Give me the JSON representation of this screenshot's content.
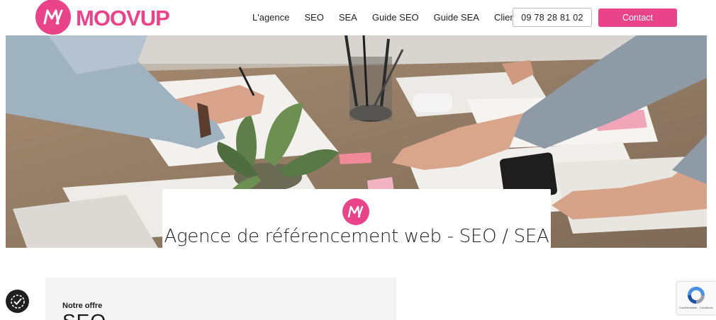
{
  "brand": {
    "name": "MOOVUP",
    "accent": "#e9448a",
    "logo_icon": "moovup-m-icon"
  },
  "nav": {
    "items": [
      {
        "label": "L'agence"
      },
      {
        "label": "SEO"
      },
      {
        "label": "SEA"
      },
      {
        "label": "Guide SEO"
      },
      {
        "label": "Guide SEA"
      },
      {
        "label": "Clients"
      }
    ],
    "phone": "09 78 28 81 02",
    "contact": "Contact"
  },
  "hero": {
    "image": "office-desk-photo",
    "title": "Agence de référencement web - SEO / SEA"
  },
  "offer": {
    "eyebrow": "Notre offre",
    "title": "SEO"
  },
  "widgets": {
    "accessibility_icon": "accessibility-check-icon",
    "recaptcha_text": "Confidentialité - Conditions"
  }
}
